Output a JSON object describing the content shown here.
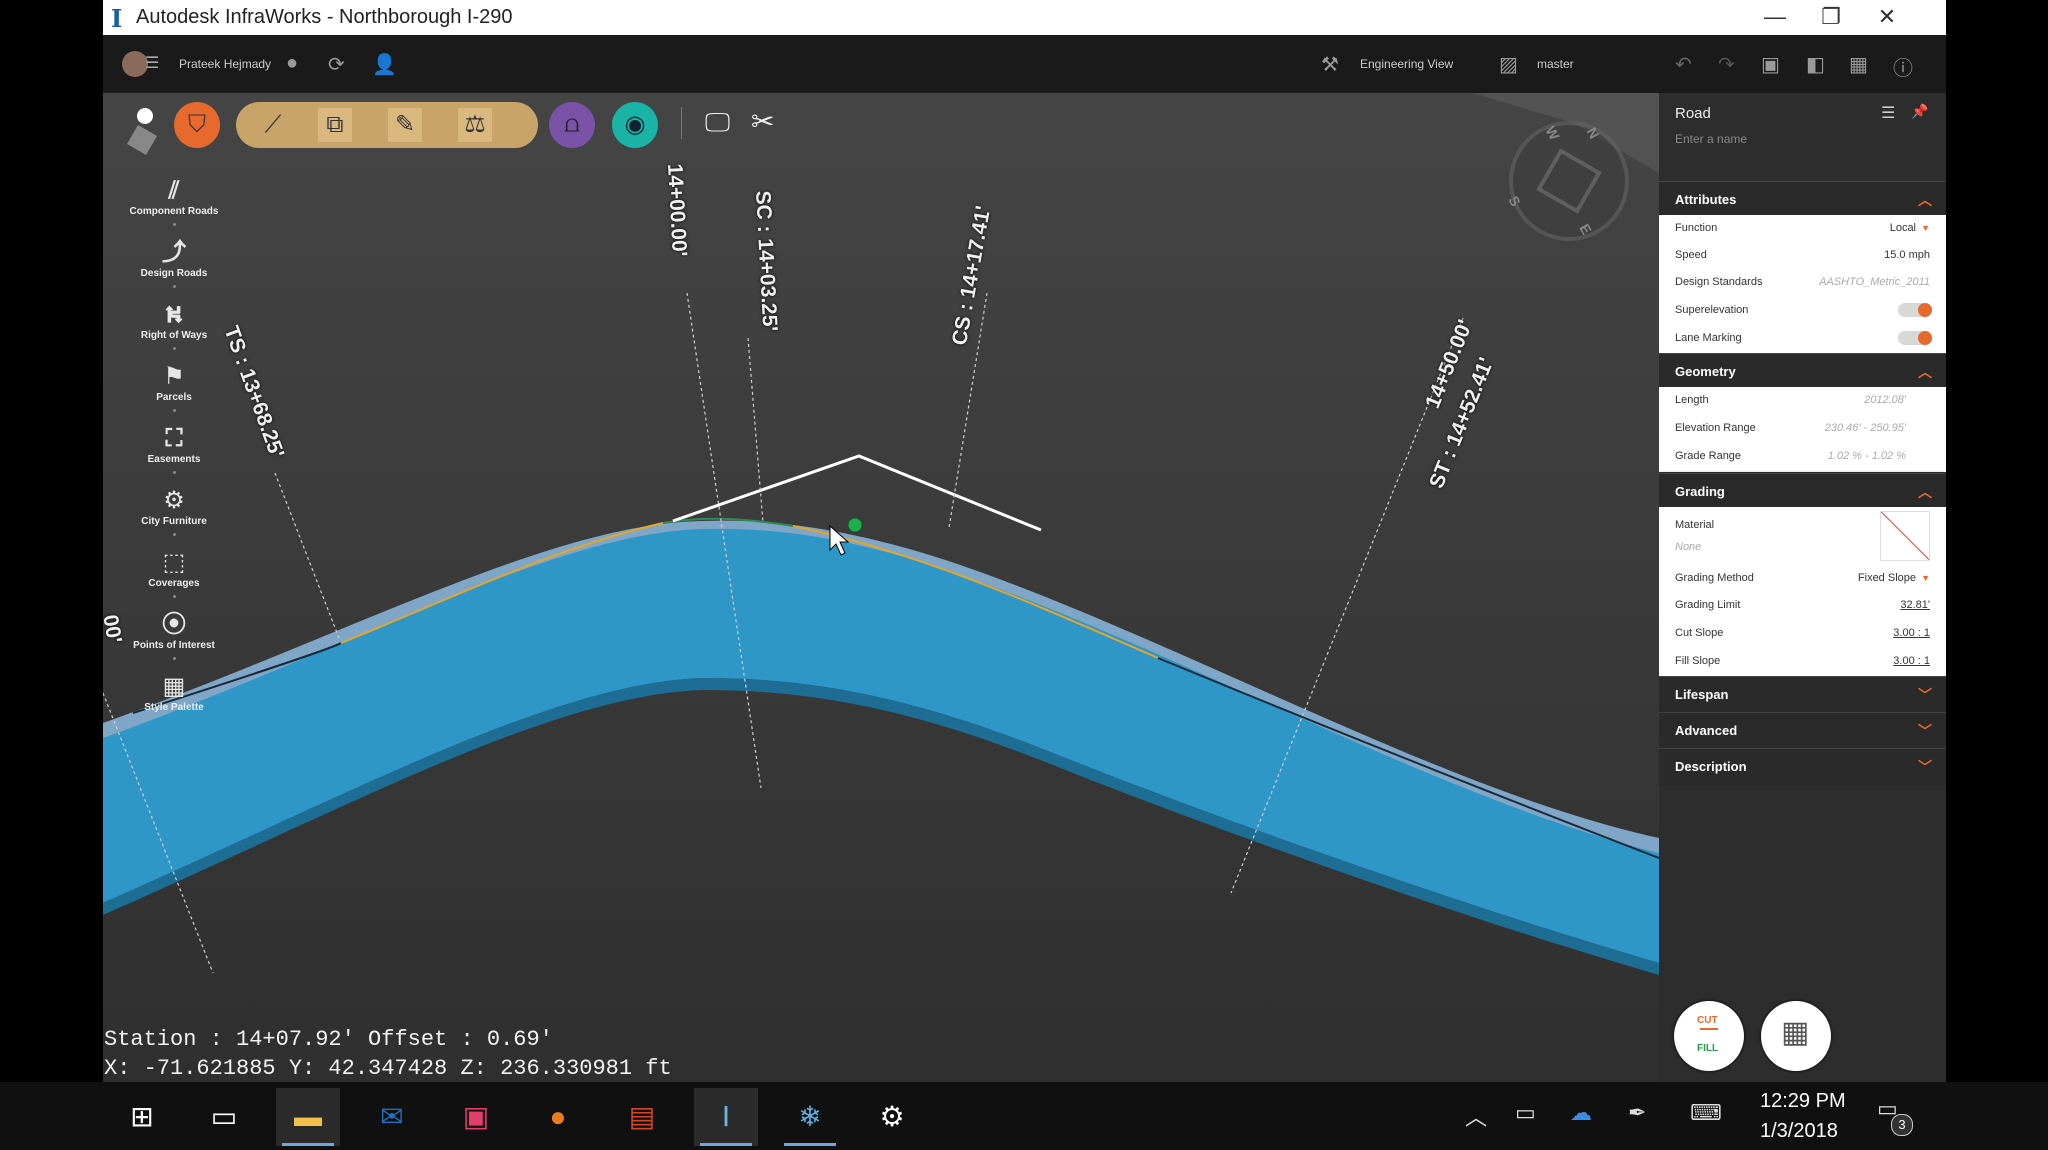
{
  "window": {
    "title": "Autodesk InfraWorks - Northborough I-290",
    "app_icon": "I",
    "controls": {
      "minimize": "—",
      "restore": "❐",
      "close": "✕"
    }
  },
  "appbar": {
    "user_name": "Prateek Hejmady",
    "view_mode": "Engineering View",
    "branch": "master"
  },
  "toolbar": {
    "icons": [
      "component-roads-tool",
      "copy-tool",
      "pencil-tool",
      "balance-tool",
      "bridge-tool",
      "drainage-tool",
      "present-tool",
      "settings-tool"
    ]
  },
  "sidebar": {
    "items": [
      {
        "label": "Component Roads",
        "icon": "component-roads-icon"
      },
      {
        "label": "Design Roads",
        "icon": "design-roads-icon"
      },
      {
        "label": "Right of Ways",
        "icon": "right-of-ways-icon"
      },
      {
        "label": "Parcels",
        "icon": "parcels-icon"
      },
      {
        "label": "Easements",
        "icon": "easements-icon"
      },
      {
        "label": "City Furniture",
        "icon": "city-furniture-icon"
      },
      {
        "label": "Coverages",
        "icon": "coverages-icon"
      },
      {
        "label": "Points of Interest",
        "icon": "points-of-interest-icon"
      },
      {
        "label": "Style Palette",
        "icon": "style-palette-icon"
      }
    ]
  },
  "viewport": {
    "stations": {
      "ts": "TS : 13+68.25'",
      "s1400": "14+00.00'",
      "sc": "SC : 14+03.25'",
      "cs": "CS : 14+17.41'",
      "s1450": "14+50.00'",
      "st": "ST : 14+52.41'",
      "left_partial": "00'"
    },
    "compass": [
      "N",
      "E",
      "S",
      "W"
    ],
    "readout_line1": "Station : 14+07.92' Offset : 0.69'",
    "readout_line2": "X: -71.621885 Y: 42.347428 Z: 236.330981 ft"
  },
  "panel": {
    "header": "Road",
    "name_placeholder": "Enter a name",
    "attributes": {
      "title": "Attributes",
      "function_label": "Function",
      "function_value": "Local",
      "speed_label": "Speed",
      "speed_value": "15.0 mph",
      "design_standards_label": "Design Standards",
      "design_standards_value": "AASHTO_Metric_2011",
      "superelevation_label": "Superelevation",
      "lane_marking_label": "Lane Marking"
    },
    "geometry": {
      "title": "Geometry",
      "length_label": "Length",
      "length_value": "2012.08'",
      "elevation_label": "Elevation Range",
      "elevation_value": "230.46' - 250.95'",
      "grade_label": "Grade Range",
      "grade_value": "1.02 % - 1.02 %"
    },
    "grading": {
      "title": "Grading",
      "material_label": "Material",
      "material_value": "None",
      "method_label": "Grading Method",
      "method_value": "Fixed Slope",
      "limit_label": "Grading Limit",
      "limit_value": "32.81'",
      "cut_label": "Cut Slope",
      "cut_value": "3.00 : 1",
      "fill_label": "Fill Slope",
      "fill_value": "3.00 : 1"
    },
    "lifespan": "Lifespan",
    "advanced": "Advanced",
    "description": "Description",
    "cut_fill": {
      "cut": "CUT",
      "fill": "FILL"
    }
  },
  "taskbar": {
    "time": "12:29 PM",
    "date": "1/3/2018",
    "notification_count": "3"
  }
}
